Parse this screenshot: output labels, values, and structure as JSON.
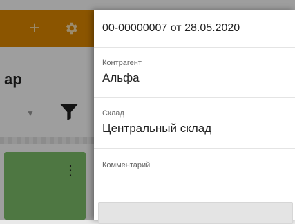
{
  "background": {
    "title_partial": "ар",
    "card_color": "#7fc16b",
    "topbar_color": "#e08a00",
    "icons": [
      "plus-icon",
      "gear-icon",
      "filter-icon",
      "kebab-menu-icon",
      "chevron-down-icon"
    ]
  },
  "drawer": {
    "header_title": "00-00000007 от 28.05.2020",
    "fields": [
      {
        "label": "Контрагент",
        "value": "Альфа"
      },
      {
        "label": "Склад",
        "value": "Центральный склад"
      },
      {
        "label": "Комментарий",
        "value": ""
      }
    ]
  }
}
